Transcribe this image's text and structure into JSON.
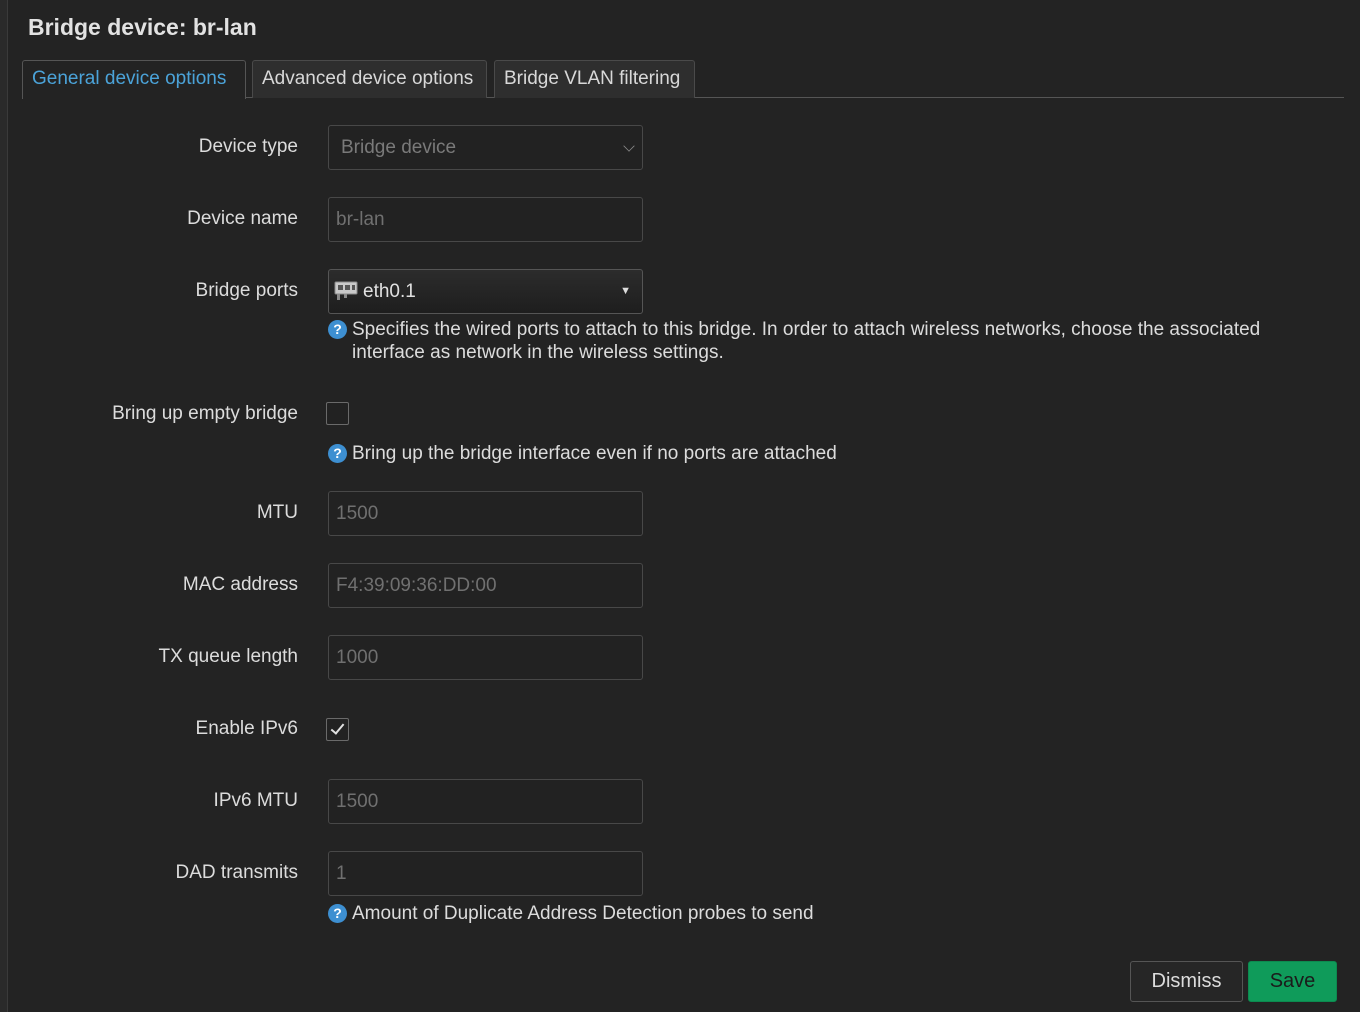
{
  "modal": {
    "title": "Bridge device: br-lan"
  },
  "tabs": [
    {
      "label": "General device options",
      "active": true
    },
    {
      "label": "Advanced device options",
      "active": false
    },
    {
      "label": "Bridge VLAN filtering",
      "active": false
    }
  ],
  "form": {
    "device_type": {
      "label": "Device type",
      "value": "Bridge device"
    },
    "device_name": {
      "label": "Device name",
      "value": "br-lan"
    },
    "bridge_ports": {
      "label": "Bridge ports",
      "value": "eth0.1",
      "icon": "ethernet-port-icon",
      "help": "Specifies the wired ports to attach to this bridge. In order to attach wireless networks, choose the associated interface as network in the wireless settings."
    },
    "empty_bridge": {
      "label": "Bring up empty bridge",
      "checked": false,
      "help": "Bring up the bridge interface even if no ports are attached"
    },
    "mtu": {
      "label": "MTU",
      "placeholder": "1500"
    },
    "mac": {
      "label": "MAC address",
      "placeholder": "F4:39:09:36:DD:00"
    },
    "txqueue": {
      "label": "TX queue length",
      "placeholder": "1000"
    },
    "ipv6": {
      "label": "Enable IPv6",
      "checked": true
    },
    "ipv6_mtu": {
      "label": "IPv6 MTU",
      "placeholder": "1500"
    },
    "dad": {
      "label": "DAD transmits",
      "placeholder": "1",
      "help": "Amount of Duplicate Address Detection probes to send"
    }
  },
  "help_glyph": "?",
  "buttons": {
    "dismiss": "Dismiss",
    "save": "Save"
  },
  "colors": {
    "accent": "#4ba3d9",
    "save": "#0f9b5a",
    "help_icon": "#3d8fd1"
  }
}
